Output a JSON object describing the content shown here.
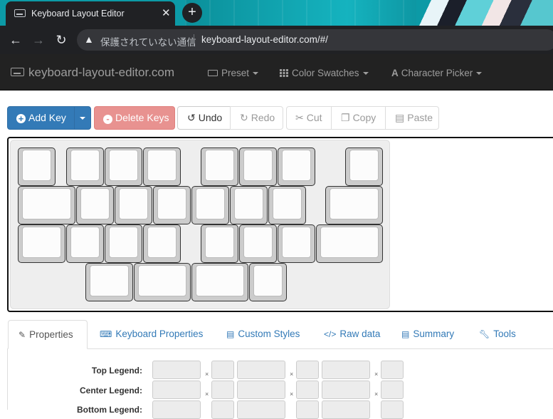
{
  "browser": {
    "tab_title": "Keyboard Layout Editor",
    "tab_close": "✕",
    "new_tab": "+",
    "back_icon": "arrow-left",
    "forward_icon": "arrow-right",
    "reload_icon": "reload",
    "back": "←",
    "forward": "→",
    "reload": "↻",
    "security_warning": "保護されていない通信",
    "warning_glyph": "▲",
    "url": "keyboard-layout-editor.com/#/"
  },
  "navbar": {
    "brand": "keyboard-layout-editor.com",
    "menus": [
      {
        "label": "Preset",
        "icon": "keyboard-icon"
      },
      {
        "label": "Color Swatches",
        "icon": "grid-icon"
      },
      {
        "label": "Character Picker",
        "icon": "font-icon"
      }
    ]
  },
  "actions": {
    "add_key": "Add Key",
    "delete_keys": "Delete Keys",
    "undo": "Undo",
    "redo": "Redo",
    "cut": "Cut",
    "copy": "Copy",
    "paste": "Paste"
  },
  "tabs": [
    {
      "label": "Properties",
      "active": true
    },
    {
      "label": "Keyboard Properties",
      "active": false
    },
    {
      "label": "Custom Styles",
      "active": false
    },
    {
      "label": "Raw data",
      "active": false
    },
    {
      "label": "Summary",
      "active": false
    },
    {
      "label": "Tools",
      "active": false
    }
  ],
  "properties": {
    "fields": [
      "Top Legend:",
      "Center Legend:",
      "Bottom Legend:"
    ],
    "x_mark": "×"
  },
  "colors": {
    "primary": "#337ab7",
    "danger": "#d9534f",
    "navbar": "#222222",
    "keycap": "#fcfcfc",
    "key_side": "#cccccc"
  }
}
